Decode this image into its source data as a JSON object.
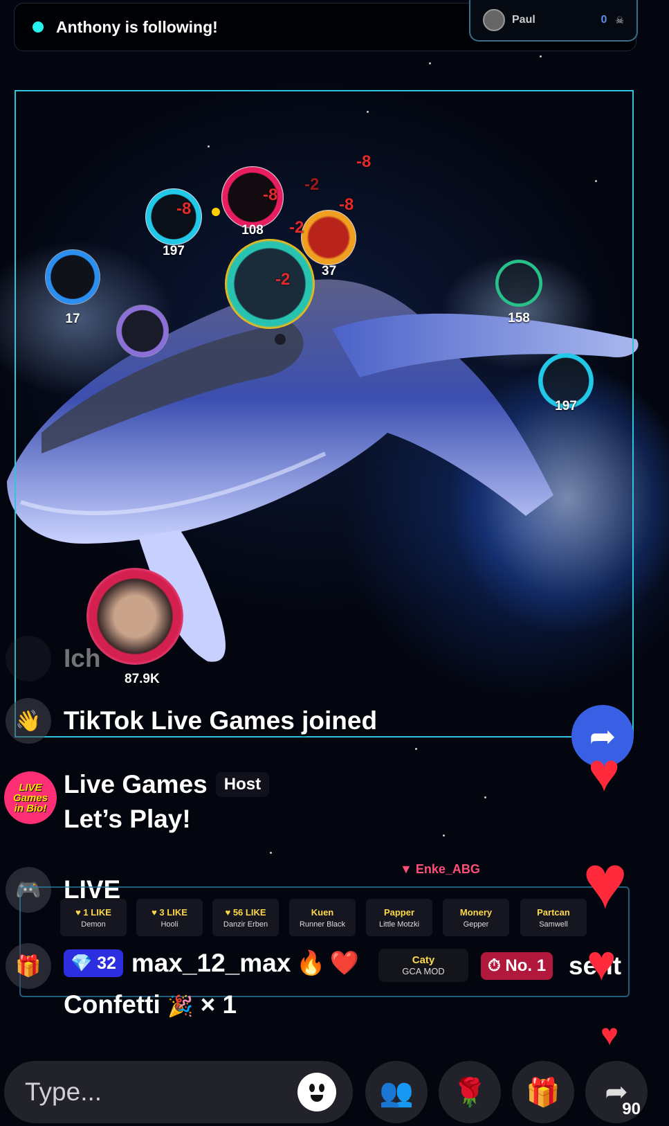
{
  "notification": {
    "text": "Anthony is following!"
  },
  "top_player": {
    "name": "Paul",
    "score": "0"
  },
  "orbs": [
    {
      "label": "197"
    },
    {
      "label": "108"
    },
    {
      "label": "37"
    },
    {
      "label": "17"
    },
    {
      "label": "158"
    },
    {
      "label": "197"
    },
    {
      "label": "87.9K"
    }
  ],
  "damage_values": [
    "-8",
    "-8",
    "-2",
    "-8",
    "-8",
    "-2",
    "-2"
  ],
  "chat": {
    "faded_line": "Ich",
    "joined_line": "TikTok Live Games joined",
    "host_name": "Live Games",
    "host_badge": "Host",
    "host_message": "Let’s Play!",
    "live_line": "LIVE",
    "avatar_lines": [
      "LIVE",
      "Games",
      "in Bio!"
    ]
  },
  "leaderboard": {
    "top_name": "▼ Enke_ABG",
    "items": [
      {
        "value": "♥ 1 LIKE",
        "name": "Demon"
      },
      {
        "value": "♥ 3 LIKE",
        "name": "Hooli"
      },
      {
        "value": "♥ 56 LIKE",
        "name": "Danzir Erben"
      },
      {
        "value": "Kuen",
        "name": "Runner Black"
      },
      {
        "value": "Papper",
        "name": "Little Motzki"
      },
      {
        "value": "Monery",
        "name": "Gepper"
      },
      {
        "value": "Partcan",
        "name": "Samwell"
      }
    ]
  },
  "gift_event": {
    "gem_count": "32",
    "user": "max_12_max",
    "mod_name": "Caty",
    "mod_role": "GCA MOD",
    "rank_badge": "No. 1",
    "sent_text": "sent",
    "gift_line": "Confetti",
    "gift_count": "× 1"
  },
  "input": {
    "placeholder": "Type..."
  },
  "share": {
    "count": "90"
  },
  "colors": {
    "accent": "#25f4ee",
    "arena_border": "#2dc4dc",
    "damage": "#e22a2a",
    "share_blue": "#3960e4"
  }
}
